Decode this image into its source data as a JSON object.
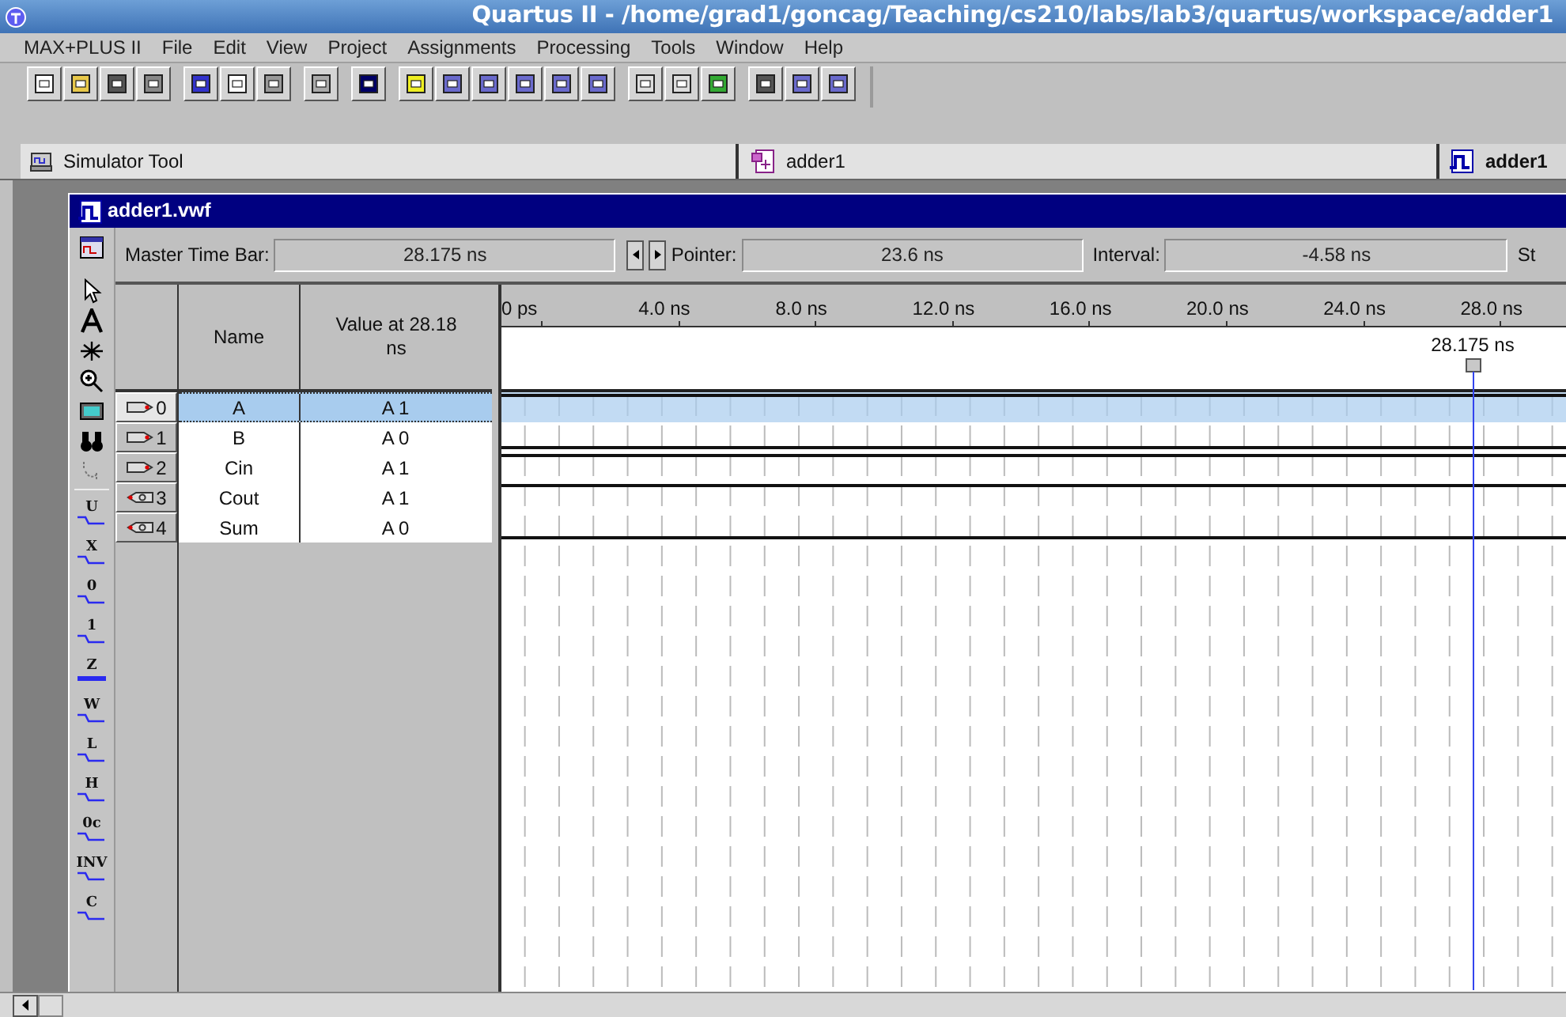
{
  "window": {
    "title": "Quartus II - /home/grad1/goncag/Teaching/cs210/labs/lab3/quartus/workspace/adder1"
  },
  "menu": [
    "MAX+PLUS II",
    "File",
    "Edit",
    "View",
    "Project",
    "Assignments",
    "Processing",
    "Tools",
    "Window",
    "Help"
  ],
  "doc_tabs": [
    {
      "label": "Simulator Tool",
      "kind": "simulator"
    },
    {
      "label": "adder1",
      "kind": "design"
    },
    {
      "label": "adder1",
      "kind": "waveform"
    }
  ],
  "editor": {
    "title": "adder1.vwf",
    "time_bar": {
      "master_label": "Master Time Bar:",
      "master_value": "28.175 ns",
      "pointer_label": "Pointer:",
      "pointer_value": "23.6 ns",
      "interval_label": "Interval:",
      "interval_value": "-4.58 ns",
      "start_label": "St"
    },
    "columns": [
      "Name",
      "Value at 28.18 ns"
    ],
    "ruler": [
      "0 ps",
      "4.0 ns",
      "8.0 ns",
      "12.0 ns",
      "16.0 ns",
      "20.0 ns",
      "24.0 ns",
      "28.0 ns"
    ],
    "cursor_label": "28.175 ns",
    "value_tools": [
      "U",
      "X",
      "0",
      "1",
      "Z",
      "W",
      "L",
      "H",
      "0c",
      "INV",
      "C"
    ],
    "signals": [
      {
        "index": "0",
        "kind": "input",
        "name": "A",
        "value": "A 1",
        "high": true,
        "selected": true
      },
      {
        "index": "1",
        "kind": "input",
        "name": "B",
        "value": "A 0",
        "high": false,
        "selected": false
      },
      {
        "index": "2",
        "kind": "input",
        "name": "Cin",
        "value": "A 1",
        "high": true,
        "selected": false
      },
      {
        "index": "3",
        "kind": "output",
        "name": "Cout",
        "value": "A 1",
        "high": true,
        "selected": false
      },
      {
        "index": "4",
        "kind": "output",
        "name": "Sum",
        "value": "A 0",
        "high": false,
        "selected": false
      }
    ]
  }
}
